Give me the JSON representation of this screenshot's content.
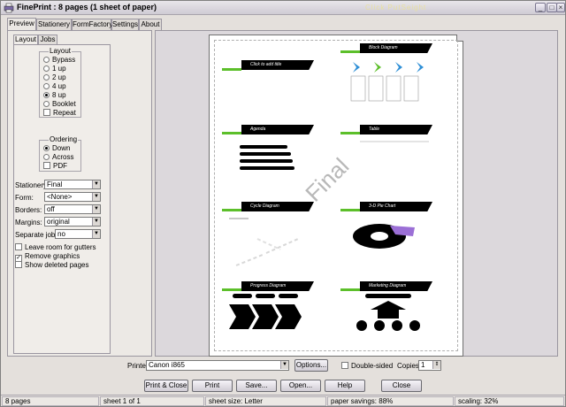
{
  "window": {
    "title": "FinePrint : 8 pages (1 sheet of paper)",
    "watermark": "Click PutSeight",
    "controls": {
      "minimize": "_",
      "maximize": "□",
      "close": "×"
    }
  },
  "tabs": [
    {
      "label": "Preview",
      "active": true
    },
    {
      "label": "Stationery",
      "active": false
    },
    {
      "label": "FormFactory",
      "active": false
    },
    {
      "label": "Settings",
      "active": false
    },
    {
      "label": "About",
      "active": false
    }
  ],
  "subtabs": [
    {
      "label": "Layout",
      "active": true
    },
    {
      "label": "Jobs",
      "active": false
    }
  ],
  "layout_group": {
    "label": "Layout",
    "options": [
      {
        "label": "Bypass",
        "type": "radio",
        "checked": false
      },
      {
        "label": "1 up",
        "type": "radio",
        "checked": false
      },
      {
        "label": "2 up",
        "type": "radio",
        "checked": false
      },
      {
        "label": "4 up",
        "type": "radio",
        "checked": false
      },
      {
        "label": "8 up",
        "type": "radio",
        "checked": true
      },
      {
        "label": "Booklet",
        "type": "radio",
        "checked": false
      },
      {
        "label": "Repeat",
        "type": "check",
        "checked": false
      }
    ]
  },
  "ordering_group": {
    "label": "Ordering",
    "options": [
      {
        "label": "Down",
        "type": "radio",
        "checked": true
      },
      {
        "label": "Across",
        "type": "radio",
        "checked": false
      },
      {
        "label": "PDF",
        "type": "check",
        "checked": false
      }
    ]
  },
  "fields": [
    {
      "label": "Stationery:",
      "value": "Final"
    },
    {
      "label": "Form:",
      "value": "<None>"
    },
    {
      "label": "Borders:",
      "value": "off"
    },
    {
      "label": "Margins:",
      "value": "original"
    },
    {
      "label": "Separate jobs:",
      "value": "no"
    }
  ],
  "checkboxes": [
    {
      "label": "Leave room for gutters",
      "checked": false
    },
    {
      "label": "Remove graphics",
      "checked": true
    },
    {
      "label": "Show deleted pages",
      "checked": false
    }
  ],
  "preview": {
    "stationery_overlay": "Final",
    "slides": [
      {
        "title": "Click to add title"
      },
      {
        "title": "Agenda"
      },
      {
        "title": "Cycle Diagram"
      },
      {
        "title": "Progress Diagram"
      },
      {
        "title": "Block Diagram"
      },
      {
        "title": "Table"
      },
      {
        "title": "3-D Pie Chart"
      },
      {
        "title": "Marketing Diagram"
      }
    ],
    "colors": {
      "accent": "#5cbf2a",
      "pie_highlight": "#9b6fd6",
      "chevron": "#2f8fd6"
    }
  },
  "printer": {
    "label": "Printer:",
    "value": "Canon i865",
    "options_label": "Options...",
    "double_sided_label": "Double-sided",
    "double_sided_checked": false,
    "copies_label": "Copies:",
    "copies_value": "1"
  },
  "buttons": {
    "print_close": "Print & Close",
    "print": "Print",
    "save": "Save...",
    "open": "Open...",
    "help": "Help",
    "close": "Close"
  },
  "status": {
    "pages": "8 pages",
    "sheet": "sheet 1 of 1",
    "sheet_size": "sheet size: Letter",
    "paper_savings": "paper savings: 88%",
    "scaling": "scaling: 32%"
  }
}
